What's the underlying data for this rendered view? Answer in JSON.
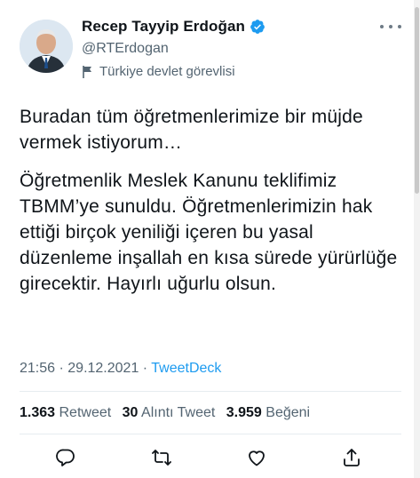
{
  "author": {
    "name": "Recep Tayyip Erdoğan",
    "handle": "@RTErdogan",
    "label": "Türkiye devlet görevlisi",
    "avatar_icon": "profile-photo",
    "verified_icon": "verified-badge-icon",
    "verified_color": "#1d9bf0"
  },
  "tweet": {
    "paragraph_1": "Buradan tüm öğretmenlerimize bir müjde vermek istiyorum…",
    "paragraph_2": "Öğretmenlik Meslek Kanunu teklifimiz TBMM’ye sunuldu. Öğretmenlerimizin hak ettiği birçok yeniliği içeren bu yasal düzenleme inşallah en kısa sürede yürürlüğe girecektir. Hayırlı uğurlu olsun."
  },
  "meta": {
    "time": "21:56",
    "separator": " · ",
    "date": "29.12.2021",
    "source": "TweetDeck",
    "source_color": "#1d9bf0"
  },
  "stats": {
    "retweets_count": "1.363",
    "retweets_label": "Retweet",
    "quotes_count": "30",
    "quotes_label": "Alıntı Tweet",
    "likes_count": "3.959",
    "likes_label": "Beğeni"
  },
  "actions": [
    {
      "icon": "reply-icon"
    },
    {
      "icon": "retweet-icon"
    },
    {
      "icon": "like-icon"
    },
    {
      "icon": "share-icon"
    }
  ]
}
